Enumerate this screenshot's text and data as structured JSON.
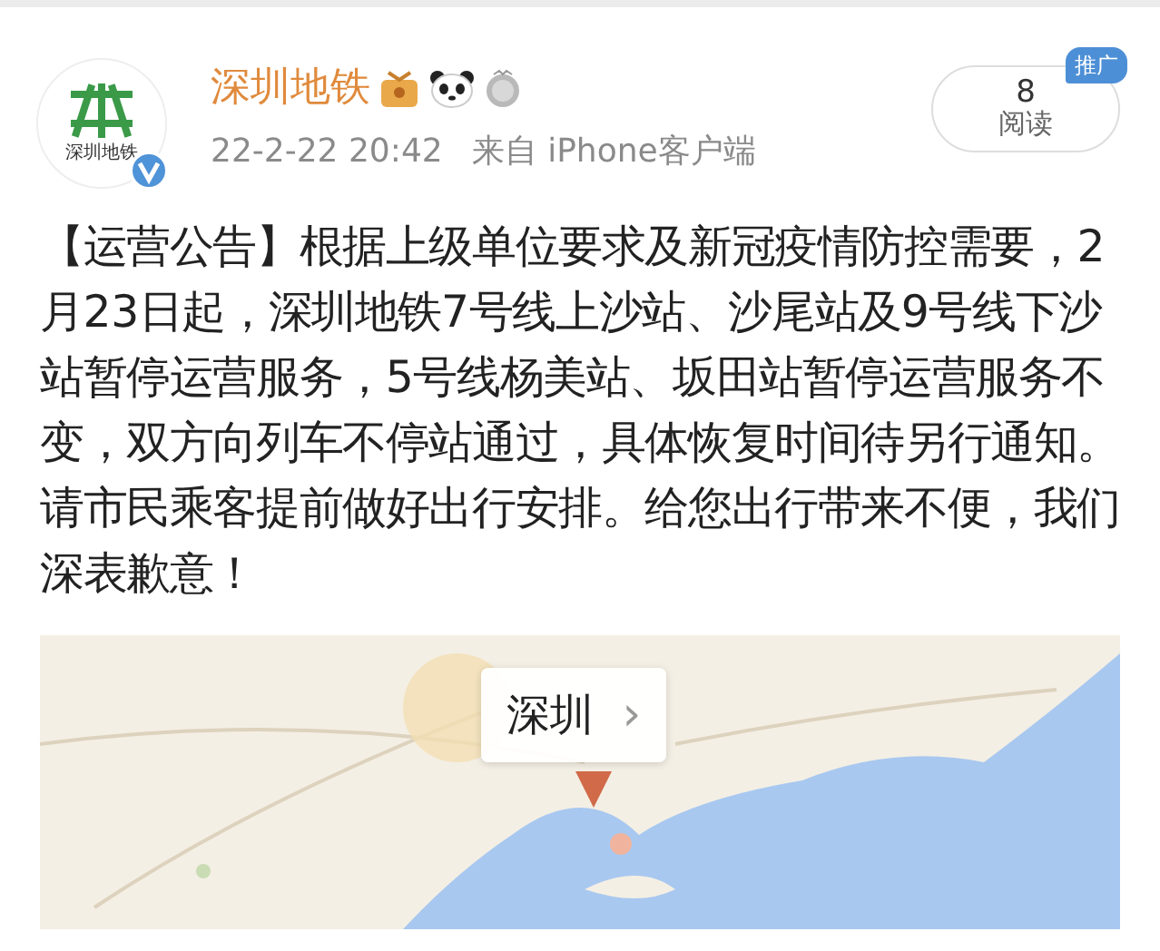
{
  "post": {
    "author": "深圳地铁",
    "avatar_text": "深圳地铁",
    "verified": true,
    "date": "22-2-22 20:42",
    "source": "来自 iPhone客户端",
    "read_count": "8",
    "read_label": "阅读",
    "promo_badge": "推广",
    "body": "【运营公告】根据上级单位要求及新冠疫情防控需要，2月23日起，深圳地铁7号线上沙站、沙尾站及9号线下沙站暂停运营服务，5号线杨美站、坂田站暂停运营服务不变，双方向列车不停站通过，具体恢复时间待另行通知。请市民乘客提前做好出行安排。给您出行带来不便，我们深表歉意！"
  },
  "map": {
    "kind": "picture",
    "location_label": "深圳",
    "chevron": "›"
  }
}
